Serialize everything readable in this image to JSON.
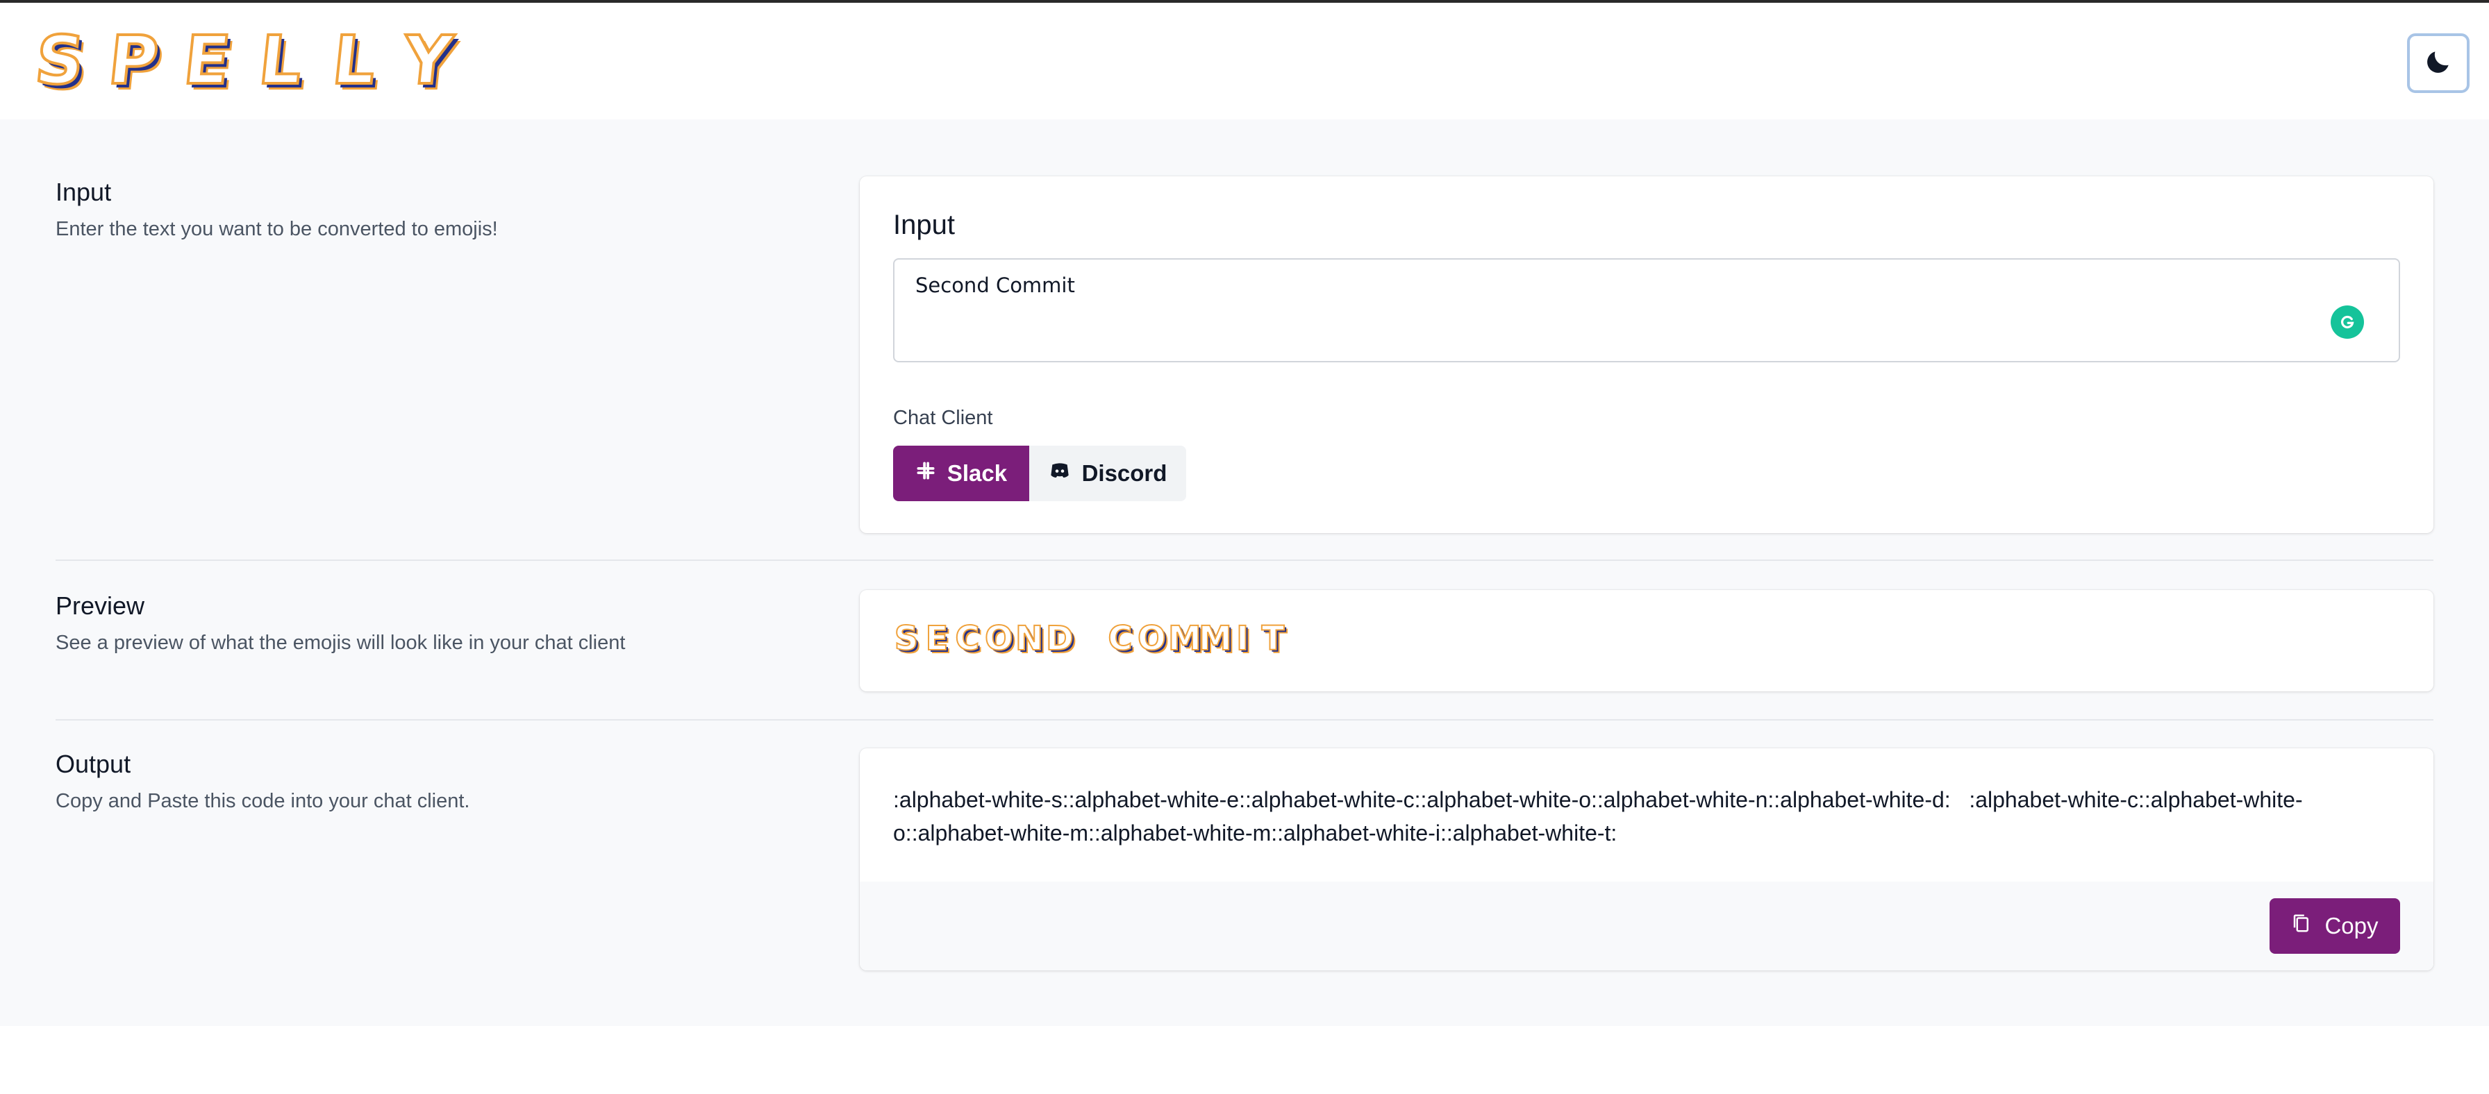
{
  "header": {
    "logo_letters": [
      "S",
      "P",
      "E",
      "L",
      "L",
      "Y"
    ],
    "theme_toggle_icon": "moon-icon"
  },
  "input_section": {
    "title": "Input",
    "description": "Enter the text you want to be converted to emojis!",
    "card_title": "Input",
    "text_value": "Second Commit",
    "grammarly_icon": "grammarly-icon",
    "chat_client_label": "Chat Client",
    "chat_clients": [
      {
        "label": "Slack",
        "icon": "slack-icon",
        "selected": true
      },
      {
        "label": "Discord",
        "icon": "discord-icon",
        "selected": false
      }
    ]
  },
  "preview_section": {
    "title": "Preview",
    "description": "See a preview of what the emojis will look like in your chat client",
    "letters": [
      "S",
      "E",
      "C",
      "O",
      "N",
      "D",
      " ",
      "C",
      "O",
      "M",
      "M",
      "I",
      "T"
    ]
  },
  "output_section": {
    "title": "Output",
    "description": "Copy and Paste this code into your chat client.",
    "code": ":alphabet-white-s::alphabet-white-e::alphabet-white-c::alphabet-white-o::alphabet-white-n::alphabet-white-d:   :alphabet-white-c::alphabet-white-o::alphabet-white-m::alphabet-white-m::alphabet-white-i::alphabet-white-t:",
    "copy_label": "Copy",
    "copy_icon": "copy-icon"
  },
  "colors": {
    "brand_purple": "#7b1e7a",
    "logo_orange": "#f0a23c",
    "logo_navy": "#23308a",
    "grammarly_green": "#15c39a"
  }
}
